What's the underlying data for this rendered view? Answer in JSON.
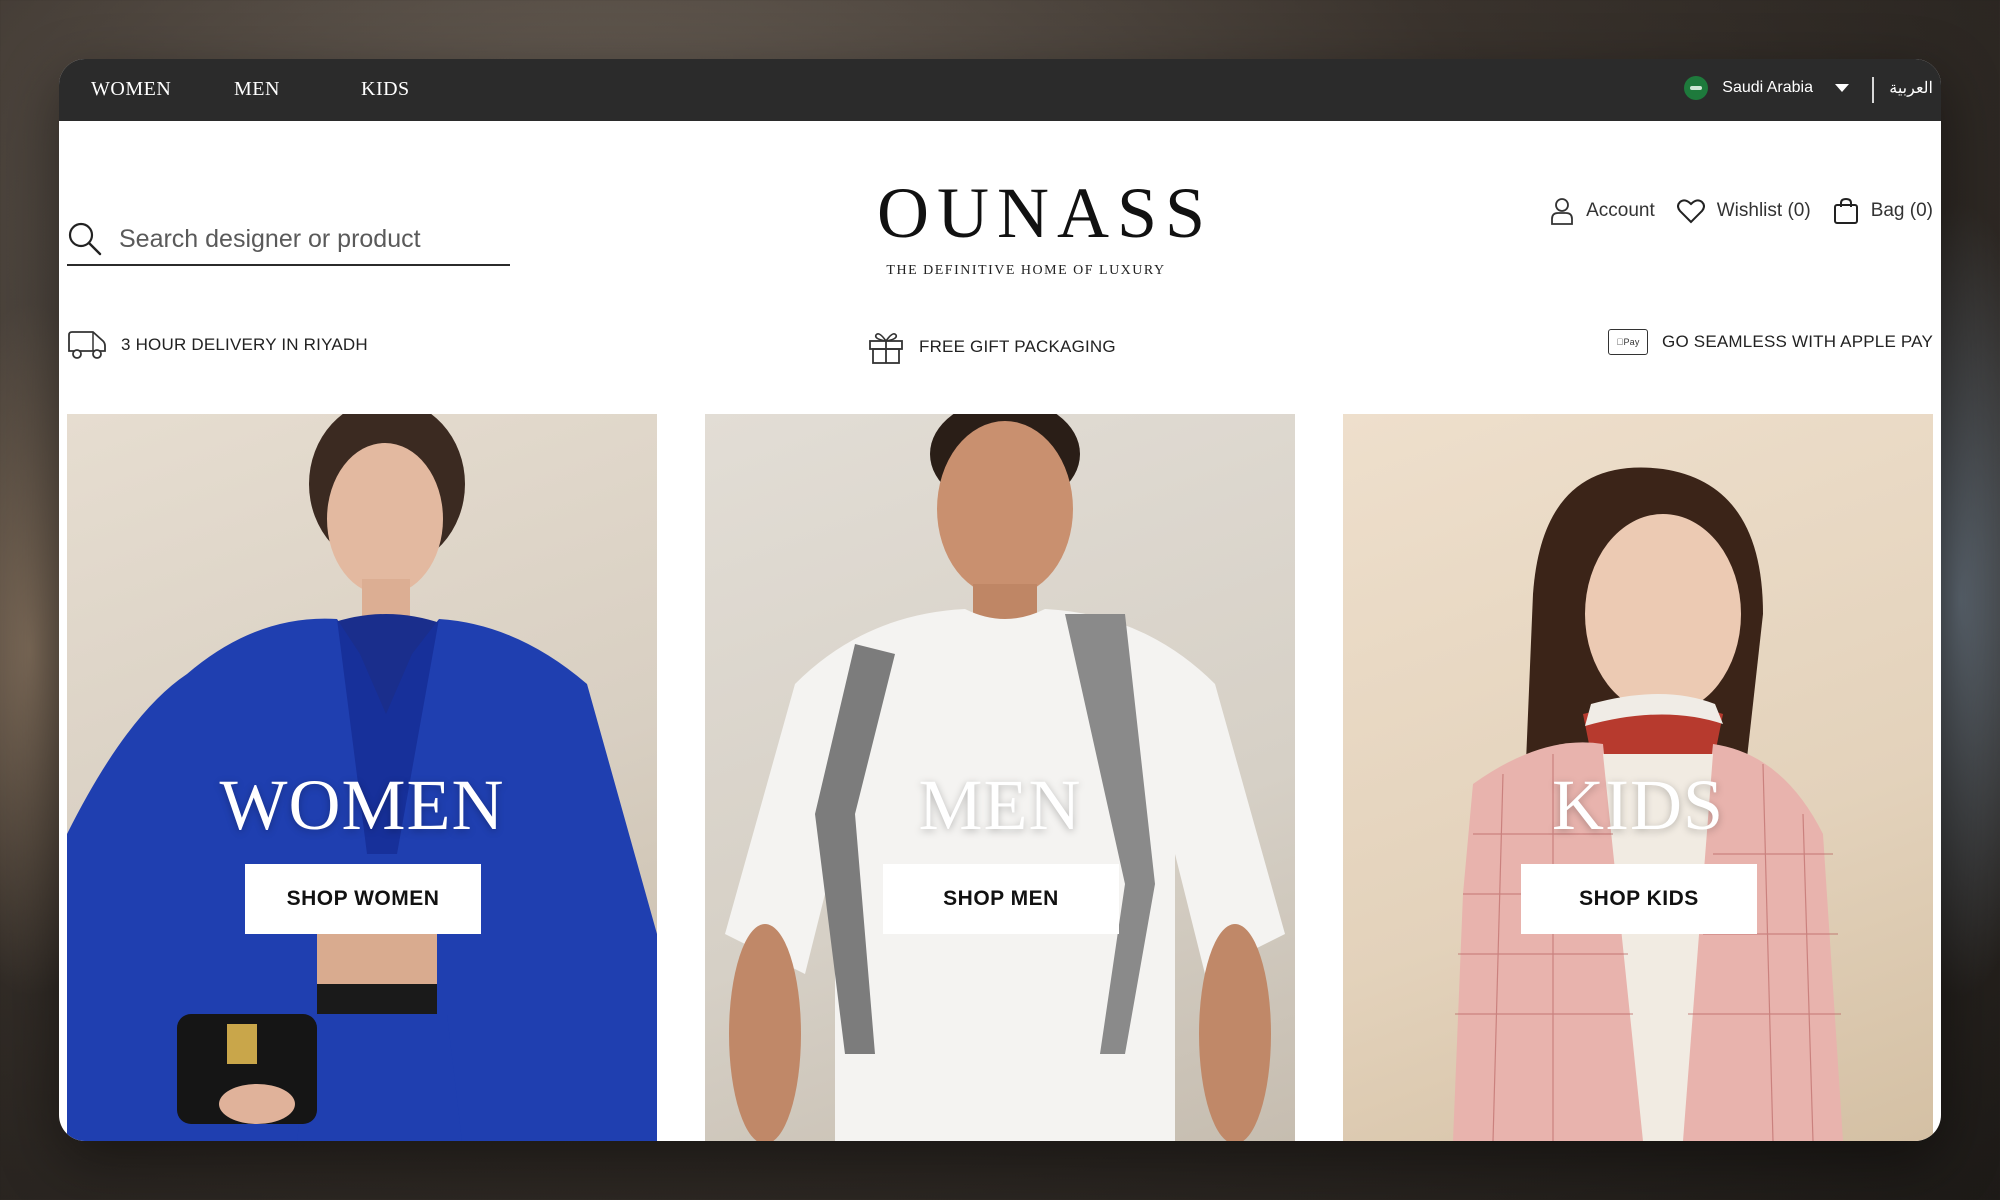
{
  "topbar": {
    "nav": [
      "WOMEN",
      "MEN",
      "KIDS"
    ],
    "country": "Saudi Arabia",
    "language": "العربية"
  },
  "header": {
    "search_placeholder": "Search designer or product",
    "logo": "OUNASS",
    "tagline": "THE DEFINITIVE HOME OF LUXURY",
    "account_label": "Account",
    "wishlist_label": "Wishlist (0)",
    "bag_label": "Bag (0)"
  },
  "usps": {
    "delivery": "3 HOUR DELIVERY IN RIYADH",
    "gift": "FREE GIFT PACKAGING",
    "applepay_badge": "Pay",
    "applepay": "GO SEAMLESS WITH APPLE PAY"
  },
  "hero": {
    "women": {
      "title": "WOMEN",
      "button": "SHOP WOMEN"
    },
    "men": {
      "title": "MEN",
      "button": "SHOP MEN"
    },
    "kids": {
      "title": "KIDS",
      "button": "SHOP KIDS"
    }
  },
  "colors": {
    "topbar": "#2b2b2b",
    "women_blazer": "#1f3fb0",
    "kids_coat": "#e8b3ad"
  }
}
